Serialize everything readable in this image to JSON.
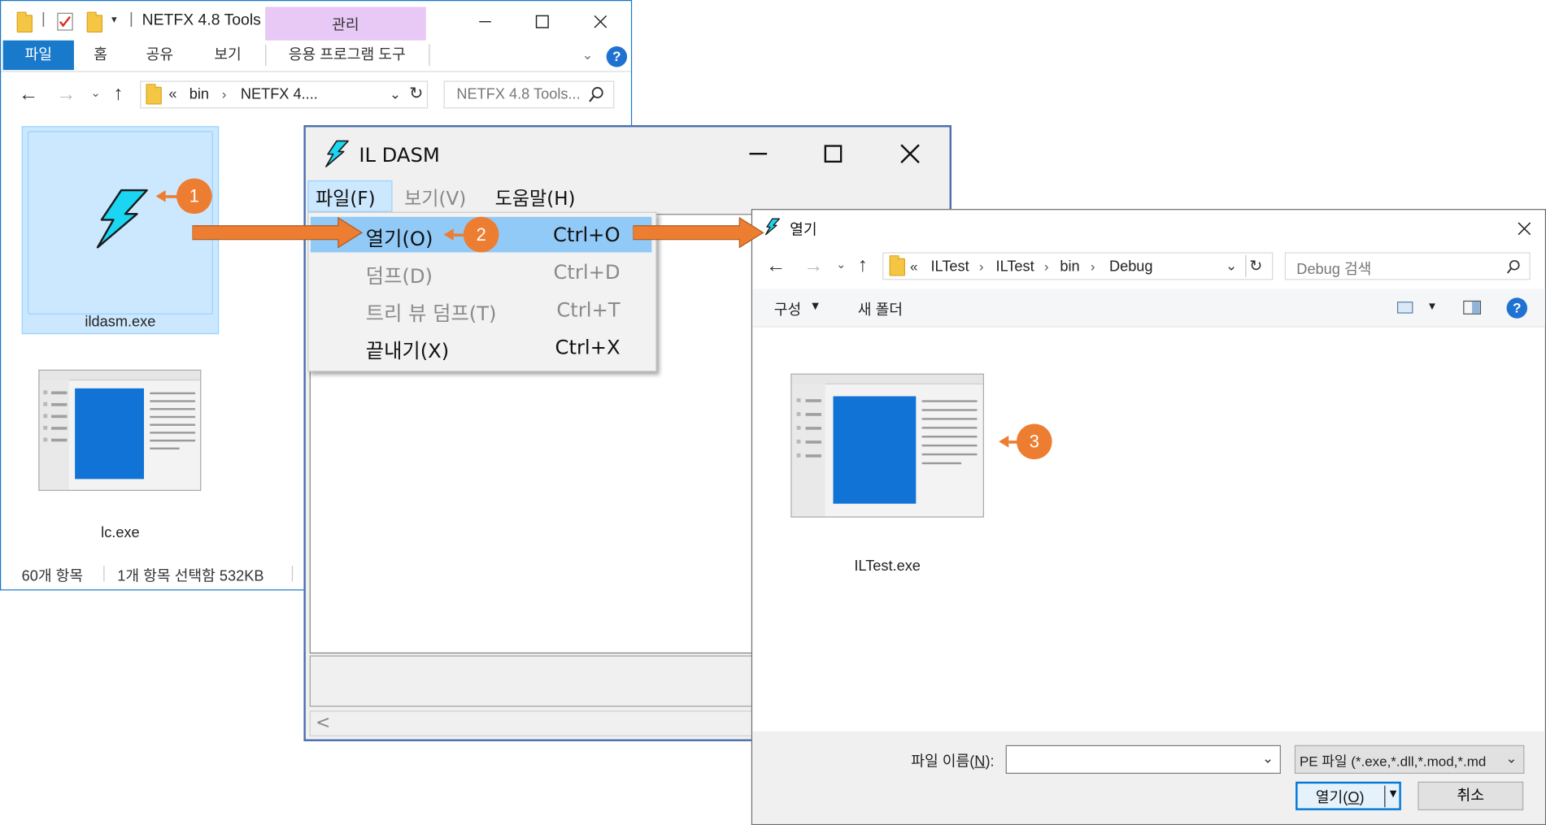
{
  "explorer": {
    "title": "NETFX 4.8 Tools",
    "context_tab": "관리",
    "ribbon_tabs": [
      "파일",
      "홈",
      "공유",
      "보기",
      "응용 프로그램 도구"
    ],
    "address": {
      "chevron": "«",
      "crumbs": [
        "bin",
        "NETFX 4...."
      ]
    },
    "search_placeholder": "NETFX 4.8 Tools...",
    "files": [
      {
        "name": "ildasm.exe",
        "selected": true,
        "icon": "lightning-bolt-icon"
      },
      {
        "name": "lc.exe",
        "selected": false,
        "icon": "app-window-icon"
      }
    ],
    "status": {
      "count": "60개 항목",
      "selected": "1개 항목 선택함 532KB"
    }
  },
  "ildasm": {
    "title": "IL DASM",
    "menubar": [
      "파일(F)",
      "보기(V)",
      "도움말(H)"
    ],
    "file_menu": [
      {
        "label": "열기(O)",
        "shortcut": "Ctrl+O",
        "enabled": true,
        "highlighted": true
      },
      {
        "label": "덤프(D)",
        "shortcut": "Ctrl+D",
        "enabled": false
      },
      {
        "label": "트리 뷰 덤프(T)",
        "shortcut": "Ctrl+T",
        "enabled": false
      },
      {
        "label": "끝내기(X)",
        "shortcut": "Ctrl+X",
        "enabled": true
      }
    ],
    "scroll_left": "<"
  },
  "open_dialog": {
    "title": "열기",
    "address": {
      "chevron": "«",
      "crumbs": [
        "ILTest",
        "ILTest",
        "bin",
        "Debug"
      ]
    },
    "search_placeholder": "Debug 검색",
    "toolbar": {
      "organize": "구성",
      "new_folder": "새 폴더"
    },
    "files": [
      {
        "name": "ILTest.exe",
        "icon": "app-window-icon"
      }
    ],
    "filename_label": "파일 이름(",
    "filename_key": "N",
    "filename_label_end": "):",
    "filename_value": "",
    "filter_value": "PE 파일 (*.exe,*.dll,*.mod,*.md",
    "open_label_pre": "열기(",
    "open_label_key": "O",
    "open_label_post": ")",
    "cancel_label": "취소"
  },
  "annotations": [
    {
      "number": "1",
      "color": "#ED7D31"
    },
    {
      "number": "2",
      "color": "#ED7D31"
    },
    {
      "number": "3",
      "color": "#ED7D31"
    }
  ],
  "colors": {
    "accent_blue": "#1979CA",
    "context_tab_purple": "#E8C8F5",
    "menu_highlight": "#91C9F7",
    "selection": "#CCE8FF",
    "annotation_orange": "#ED7D31",
    "help_blue": "#1F72D2"
  }
}
